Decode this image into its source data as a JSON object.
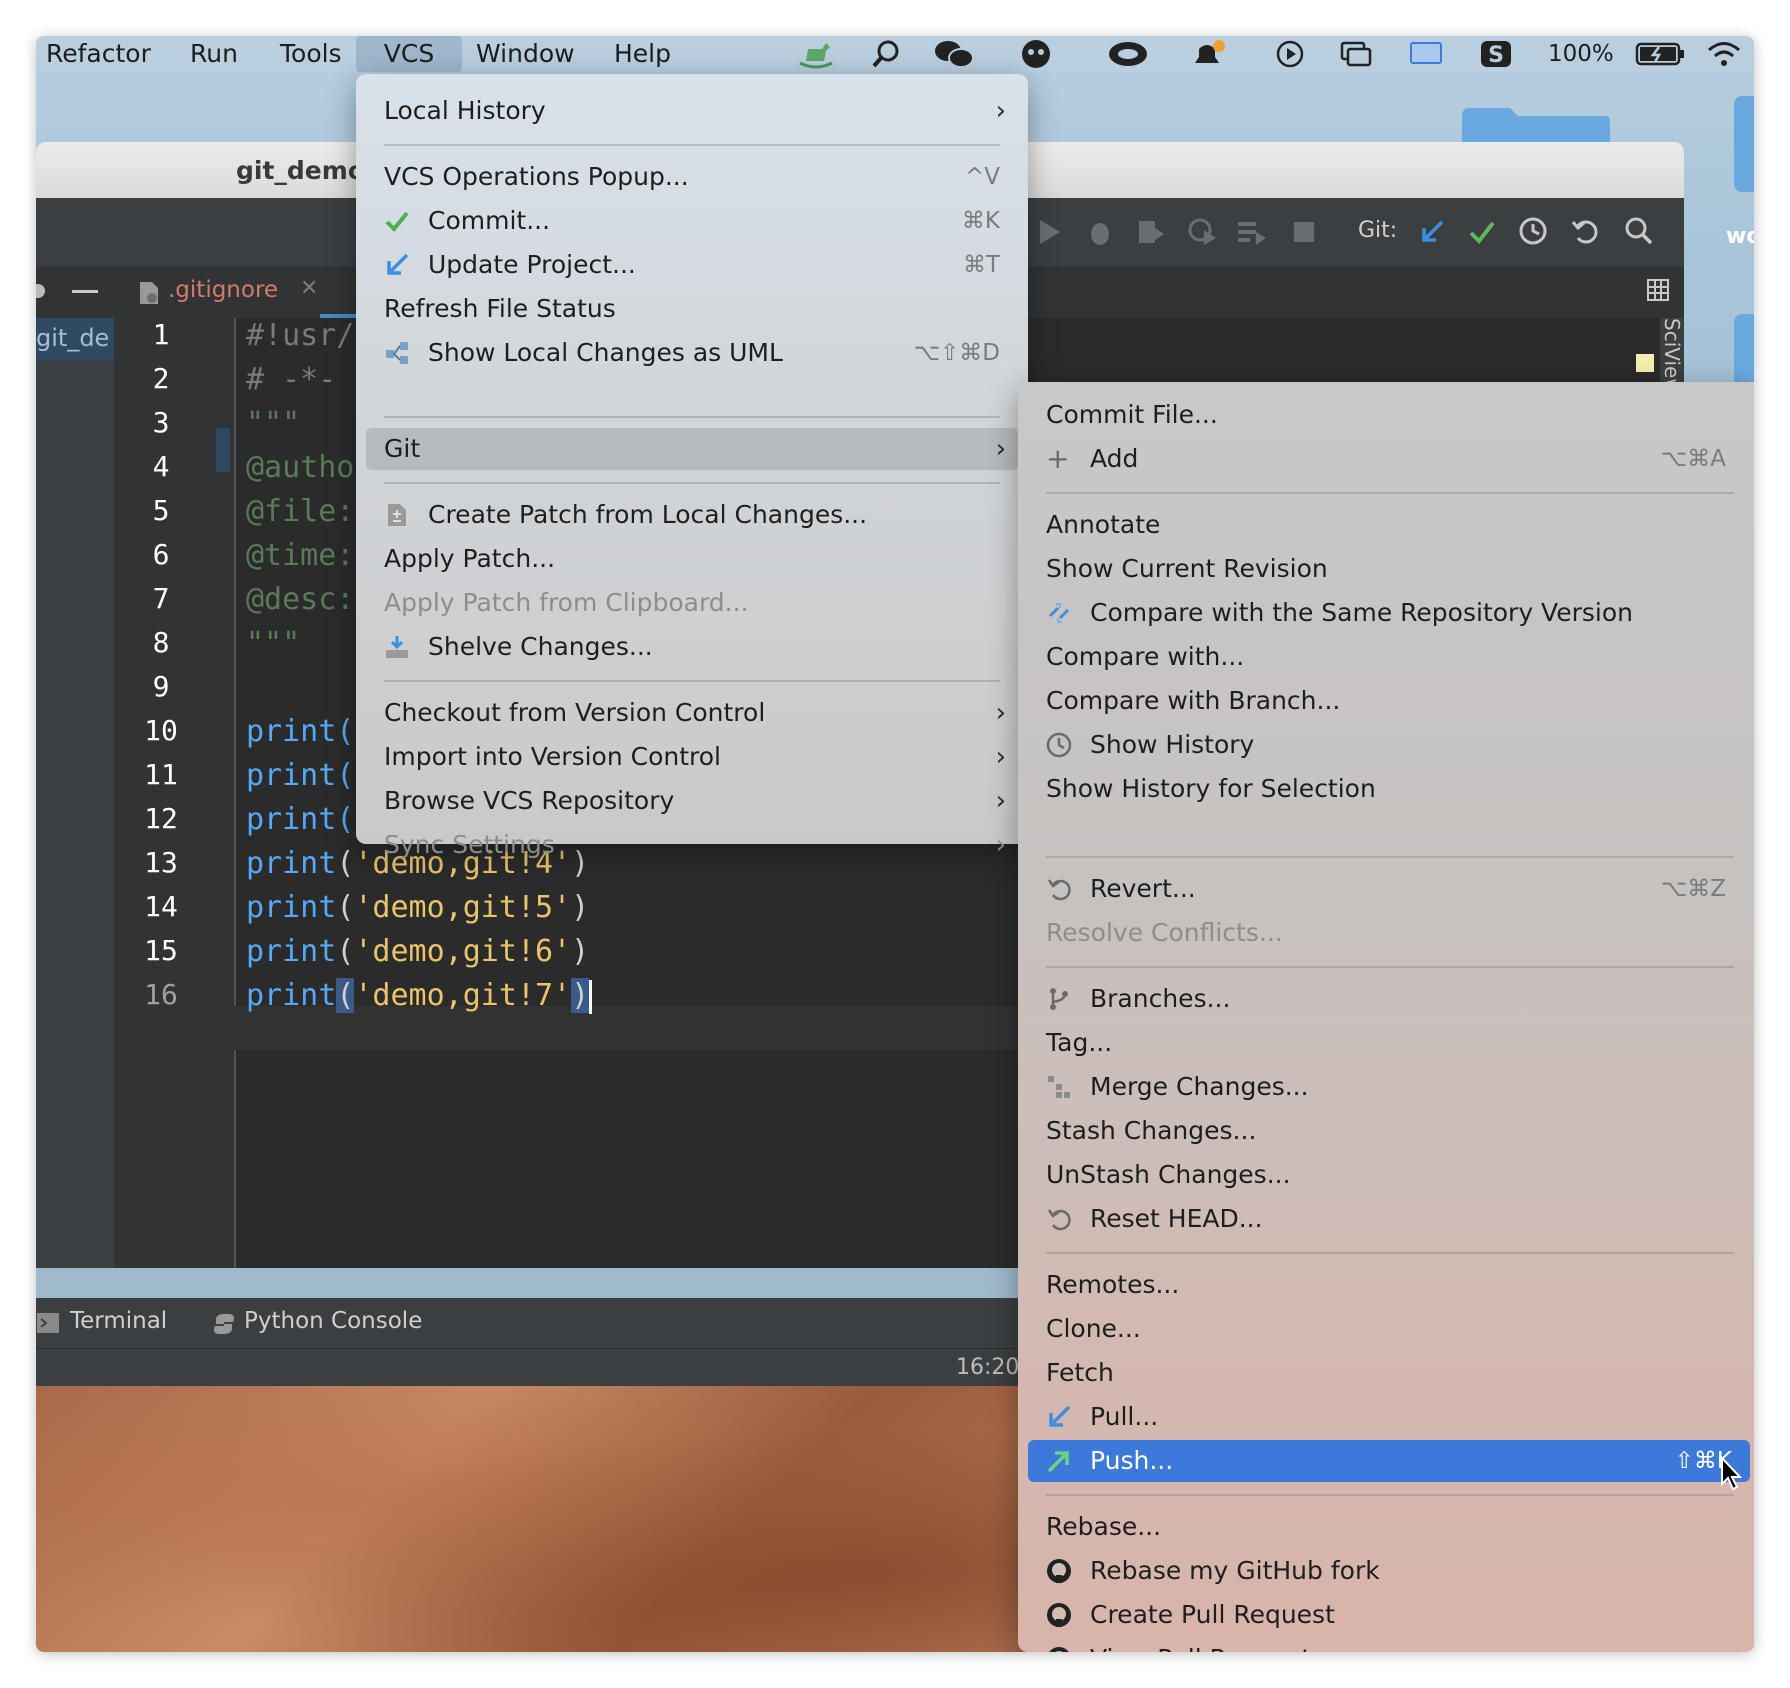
{
  "menubar": {
    "items": [
      "Refactor",
      "Run",
      "Tools",
      "VCS",
      "Window",
      "Help"
    ],
    "battery": "100%"
  },
  "ide": {
    "window_title": "git_demo",
    "project_name": "git_de",
    "tab_label": ".gitignore",
    "git_label": "Git:",
    "sciview_label": "SciView",
    "desktop_label": "wo",
    "line_numbers": [
      "1",
      "2",
      "3",
      "4",
      "5",
      "6",
      "7",
      "8",
      "9",
      "10",
      "11",
      "12",
      "13",
      "14",
      "15",
      "16"
    ],
    "code_lines": {
      "l1": "#!usr/",
      "l2": "# -*-",
      "l3": "\"\"\"",
      "l4": "@autho",
      "l5": "@file:",
      "l6": "@time:",
      "l7": "@desc:",
      "l8": "\"\"\"",
      "l10": "print(",
      "l11": "print(",
      "l12": "print(",
      "l13_kw": "print",
      "l13_str": "'demo,git!4'",
      "l14_kw": "print",
      "l14_str": "'demo,git!5'",
      "l15_kw": "print",
      "l15_str": "'demo,git!6'",
      "l16_kw": "print",
      "l16_str": "'demo,git!7'"
    },
    "bottom_tabs": [
      "Terminal",
      "Python Console"
    ],
    "cursor_position": "16:20"
  },
  "vcs_menu": {
    "local_history": "Local History",
    "operations_popup": "VCS Operations Popup...",
    "operations_popup_shortcut": "^V",
    "commit": "Commit...",
    "commit_shortcut": "⌘K",
    "update_project": "Update Project...",
    "update_project_shortcut": "⌘T",
    "refresh_status": "Refresh File Status",
    "show_uml": "Show Local Changes as UML",
    "show_uml_shortcut": "⌥⇧⌘D",
    "git": "Git",
    "create_patch": "Create Patch from Local Changes...",
    "apply_patch": "Apply Patch...",
    "apply_patch_clipboard": "Apply Patch from Clipboard...",
    "shelve": "Shelve Changes...",
    "checkout": "Checkout from Version Control",
    "import": "Import into Version Control",
    "browse": "Browse VCS Repository",
    "sync": "Sync Settings"
  },
  "git_menu": {
    "commit_file": "Commit File...",
    "add": "Add",
    "add_shortcut": "⌥⌘A",
    "annotate": "Annotate",
    "show_current_revision": "Show Current Revision",
    "compare_same_repo": "Compare with the Same Repository Version",
    "compare_with": "Compare with...",
    "compare_branch": "Compare with Branch...",
    "show_history": "Show History",
    "show_history_selection": "Show History for Selection",
    "revert": "Revert...",
    "revert_shortcut": "⌥⌘Z",
    "resolve_conflicts": "Resolve Conflicts...",
    "branches": "Branches...",
    "tag": "Tag...",
    "merge": "Merge Changes...",
    "stash": "Stash Changes...",
    "unstash": "UnStash Changes...",
    "reset_head": "Reset HEAD...",
    "remotes": "Remotes...",
    "clone": "Clone...",
    "fetch": "Fetch",
    "pull": "Pull...",
    "push": "Push...",
    "push_shortcut": "⇧⌘K",
    "rebase": "Rebase...",
    "rebase_fork": "Rebase my GitHub fork",
    "create_pr": "Create Pull Request",
    "view_prs": "View Pull Requests"
  },
  "colors": {
    "selection": "#3c79d8",
    "editor_bg": "#2b2b2b",
    "keyword": "#56a8f5",
    "string": "#e8c46a"
  }
}
